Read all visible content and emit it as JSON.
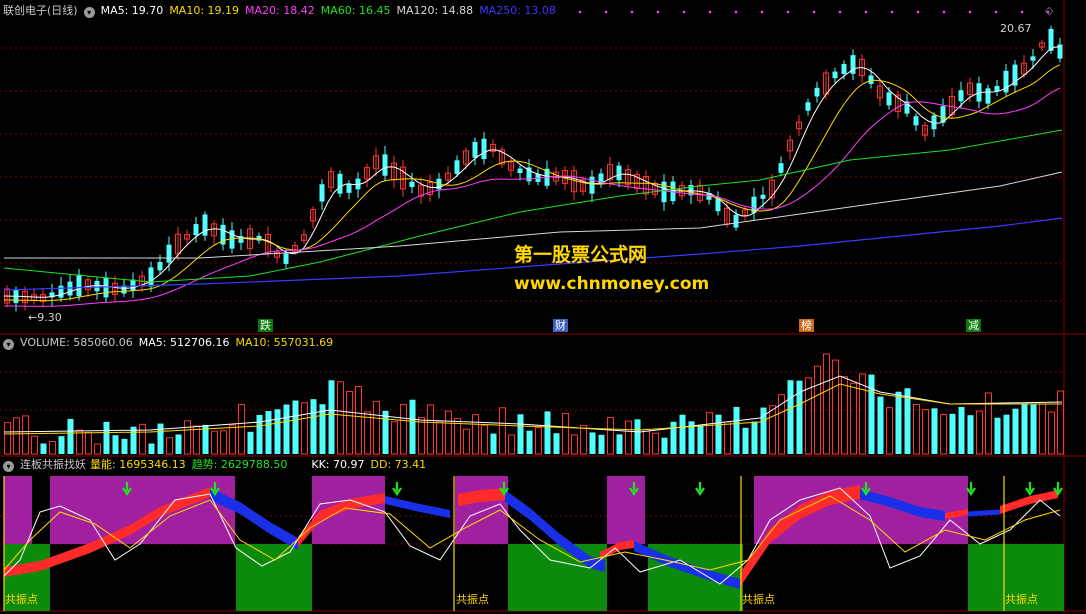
{
  "main": {
    "stock_name": "联创电子(日线)",
    "ma": [
      {
        "label": "MA5: 19.70",
        "color": "#ffffff"
      },
      {
        "label": "MA10: 19.19",
        "color": "#ffd800"
      },
      {
        "label": "MA20: 18.42",
        "color": "#ff3cff"
      },
      {
        "label": "MA60: 16.45",
        "color": "#1ee31e"
      },
      {
        "label": "MA120: 14.88",
        "color": "#d8d8d8"
      },
      {
        "label": "MA250: 13.08",
        "color": "#3a3aff"
      }
    ],
    "high_label": "20.67",
    "low_label": "9.30",
    "watermark_title": "第一股票公式网",
    "watermark_url": "www.chnmoney.com",
    "event_tags": [
      {
        "text": "跌",
        "bg": "#0a7a0a"
      },
      {
        "text": "财",
        "bg": "#3f5fbf"
      },
      {
        "text": "榜",
        "bg": "#cc6a1a"
      },
      {
        "text": "减",
        "bg": "#0a7a0a"
      }
    ]
  },
  "volume": {
    "label": "VOLUME: 585060.06",
    "ma5": "MA5: 512706.16",
    "ma10": "MA10: 557031.69"
  },
  "indicator": {
    "name": "连板共振找妖",
    "liangneng": "量能: 1695346.13",
    "qushi": "趋势: 2629788.50",
    "kk": "KK: 70.97",
    "dd": "DD: 73.41",
    "resonance_label": "共振点"
  },
  "colors": {
    "up": "#ff3232",
    "down": "#52ffff",
    "magenta_zone": "#a020a0",
    "green_zone": "#0c8a0c",
    "red_band": "#ff2a2a",
    "blue_band": "#1a30e8"
  }
}
